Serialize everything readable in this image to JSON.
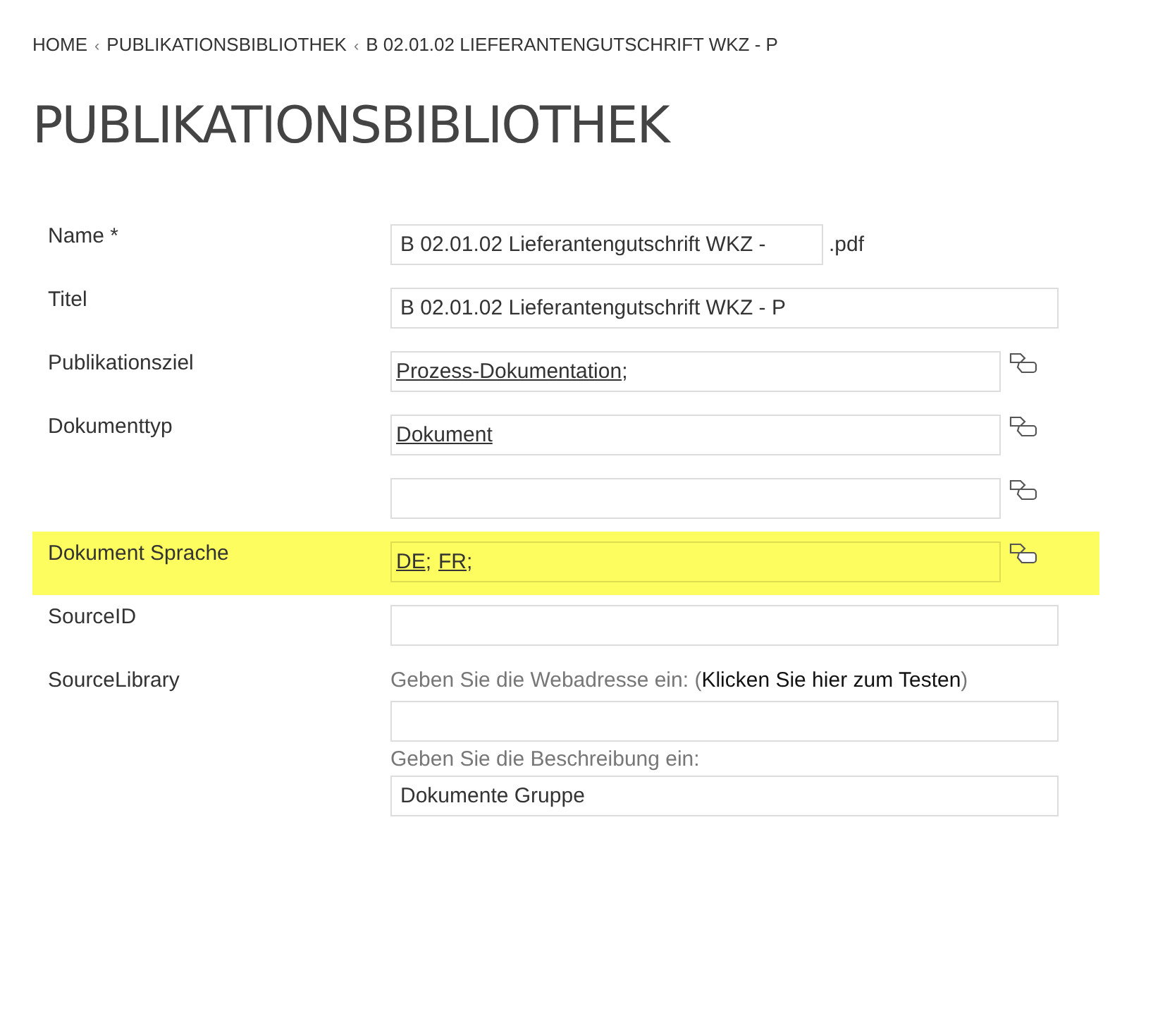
{
  "breadcrumb": {
    "items": [
      "HOME",
      "PUBLIKATIONSBIBLIOTHEK",
      "B 02.01.02 LIEFERANTENGUTSCHRIFT WKZ - P"
    ],
    "separator": "‹"
  },
  "title": "PUBLIKATIONSBIBLIOTHEK",
  "fields": [
    {
      "kind": "text",
      "label": "Name *",
      "value": "B 02.01.02 Lieferantengutschrift WKZ -",
      "suffix": ".pdf",
      "highlighted": false
    },
    {
      "kind": "text",
      "label": "Titel",
      "value": "B 02.01.02 Lieferantengutschrift WKZ - P",
      "highlighted": false
    },
    {
      "kind": "picker",
      "label": "Publikationsziel",
      "tokens": [
        {
          "link": "Prozess-Dokumentation",
          "after": ";"
        }
      ],
      "highlighted": false
    },
    {
      "kind": "picker",
      "label": "Dokumenttyp",
      "tokens": [
        {
          "link": "Dokument"
        }
      ],
      "highlighted": false
    },
    {
      "kind": "picker",
      "highlighted": false
    },
    {
      "kind": "picker",
      "label": "Dokument Sprache",
      "tokens": [
        {
          "link": "DE",
          "after": ";"
        },
        {
          "link": "FR",
          "after": ";"
        }
      ],
      "highlighted": true
    },
    {
      "kind": "text",
      "label": "SourceID",
      "highlighted": false
    },
    {
      "kind": "url",
      "label": "SourceLibrary",
      "url_hint": "Geben Sie die Webadresse ein: (",
      "test_link": "Klicken Sie hier zum Testen",
      "url_hint_end": ")",
      "description_hint": "Geben Sie die Beschreibung ein:",
      "description": "Dokumente Gruppe",
      "highlighted": false
    }
  ]
}
